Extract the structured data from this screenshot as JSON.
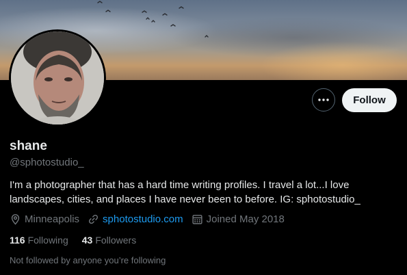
{
  "profile": {
    "name": "shane",
    "handle": "@sphotostudio_",
    "bio": "I'm a photographer that has a hard time writing profiles. I travel a lot...I love landscapes, cities, and places I have never been to before. IG: sphotostudio_",
    "location": "Minneapolis",
    "website": "sphotostudio.com",
    "joined": "Joined May 2018",
    "following_count": "116",
    "following_label": "Following",
    "followers_count": "43",
    "followers_label": "Followers",
    "followed_by_note": "Not followed by anyone you’re following"
  },
  "actions": {
    "follow_label": "Follow",
    "more_icon": "more-horizontal-icon"
  },
  "icons": {
    "location": "location-pin-icon",
    "link": "link-icon",
    "calendar": "calendar-icon"
  },
  "colors": {
    "background": "#000000",
    "link": "#1d9bf0",
    "secondary_text": "#71767b",
    "follow_button_bg": "#eff3f4"
  }
}
